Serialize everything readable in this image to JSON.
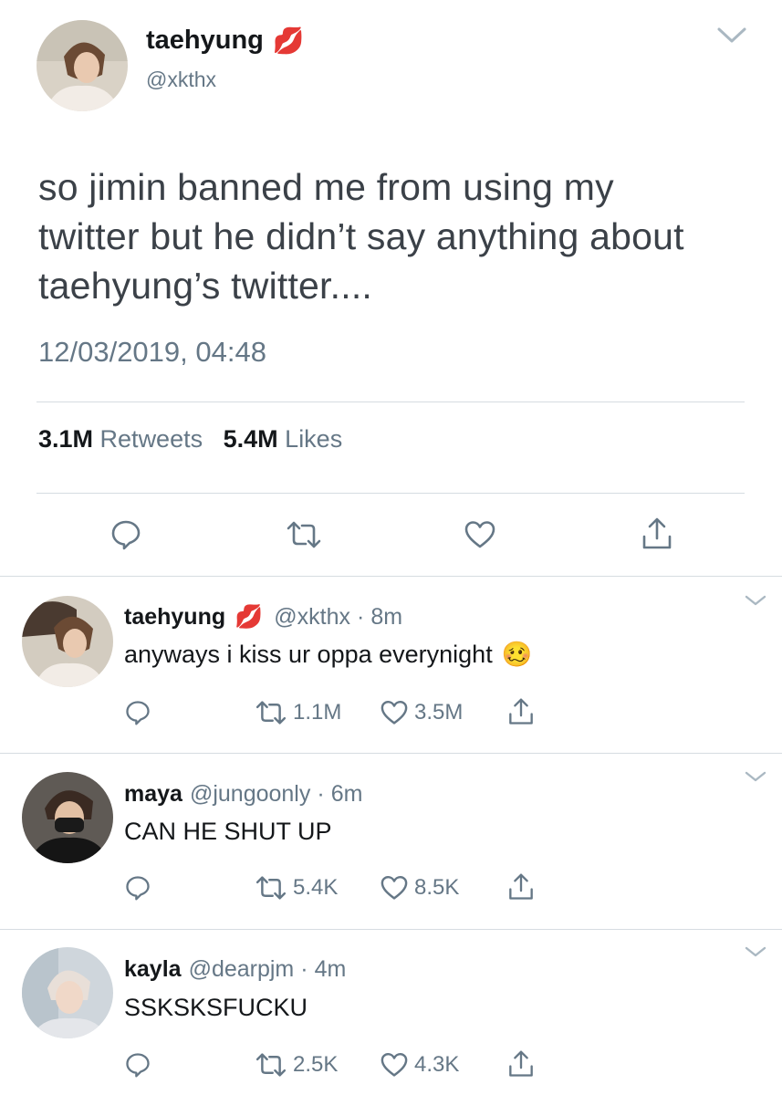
{
  "main_tweet": {
    "display_name": "taehyung",
    "name_emoji": "💋",
    "handle": "@xkthx",
    "text_lines": [
      "so jimin banned me from using my",
      "twitter but he didn’t say anything about",
      "taehyung’s twitter...."
    ],
    "timestamp": "12/03/2019, 04:48",
    "retweets_count": "3.1M",
    "retweets_label": "Retweets",
    "likes_count": "5.4M",
    "likes_label": "Likes",
    "actions": [
      "reply-icon",
      "retweet-icon",
      "like-icon",
      "share-icon"
    ]
  },
  "replies": [
    {
      "display_name": "taehyung",
      "name_emoji": "💋",
      "handle": "@xkthx",
      "separator": "·",
      "age": "8m",
      "text": "anyways i kiss ur oppa everynight",
      "text_emoji": "🥴",
      "retweets": "1.1M",
      "likes": "3.5M"
    },
    {
      "display_name": "maya",
      "handle": "@jungoonly",
      "separator": "·",
      "age": "6m",
      "text": "CAN HE SHUT UP",
      "retweets": "5.4K",
      "likes": "8.5K"
    },
    {
      "display_name": "kayla",
      "handle": "@dearpjm",
      "separator": "·",
      "age": "4m",
      "text": "SSKSKSFUCKU",
      "retweets": "2.5K",
      "likes": "4.3K"
    }
  ],
  "colors": {
    "text_primary": "#14171a",
    "text_secondary": "#657786",
    "divider": "#d6dce1",
    "lips": "#e0245e"
  }
}
